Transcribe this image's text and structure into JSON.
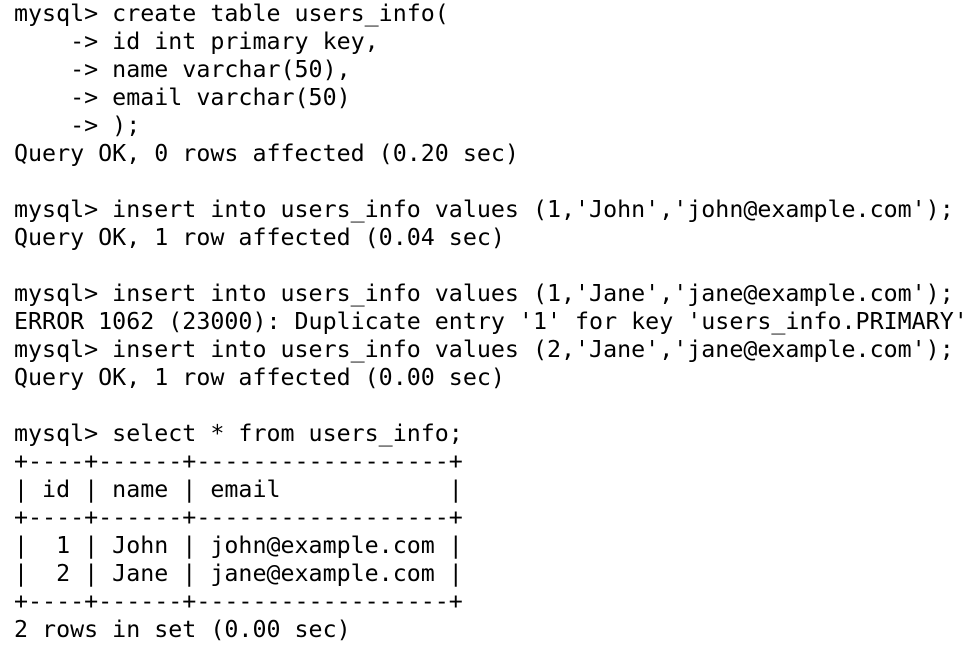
{
  "terminal": {
    "lines": [
      "mysql> create table users_info(",
      "    -> id int primary key,",
      "    -> name varchar(50),",
      "    -> email varchar(50)",
      "    -> );",
      "Query OK, 0 rows affected (0.20 sec)",
      "",
      "mysql> insert into users_info values (1,'John','john@example.com');",
      "Query OK, 1 row affected (0.04 sec)",
      "",
      "mysql> insert into users_info values (1,'Jane','jane@example.com');",
      "ERROR 1062 (23000): Duplicate entry '1' for key 'users_info.PRIMARY'",
      "mysql> insert into users_info values (2,'Jane','jane@example.com');",
      "Query OK, 1 row affected (0.00 sec)",
      "",
      "mysql> select * from users_info;",
      "+----+------+------------------+",
      "| id | name | email            |",
      "+----+------+------------------+",
      "|  1 | John | john@example.com |",
      "|  2 | Jane | jane@example.com |",
      "+----+------+------------------+",
      "2 rows in set (0.00 sec)"
    ]
  }
}
